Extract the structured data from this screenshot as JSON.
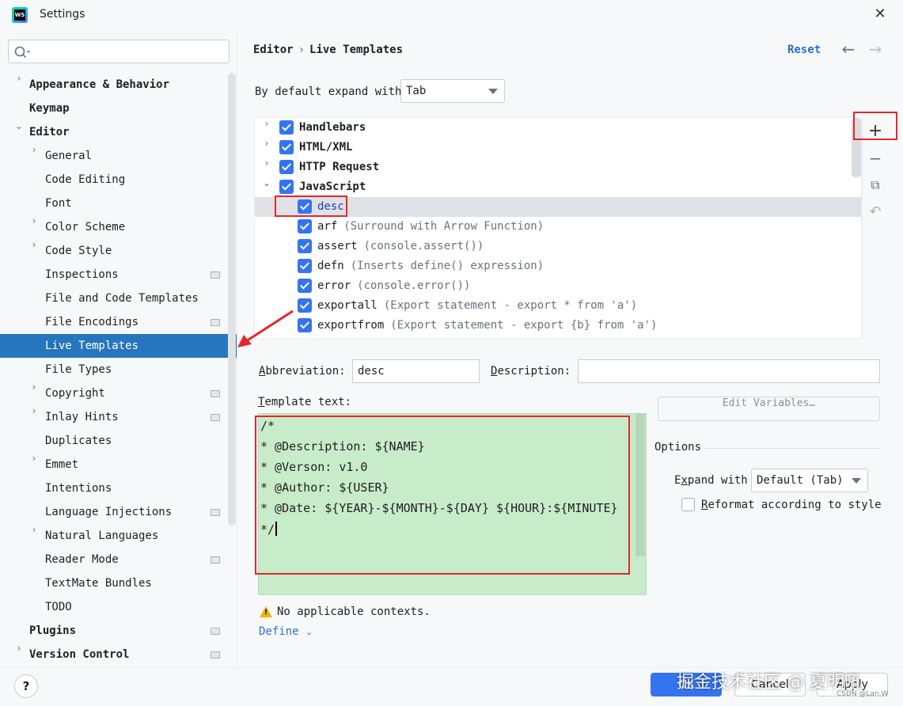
{
  "window": {
    "title": "Settings",
    "logo_text": "WS",
    "close_symbol": "✕"
  },
  "search": {
    "placeholder": ""
  },
  "sidebar": {
    "items": [
      {
        "label": "Appearance & Behavior",
        "level": 0,
        "chevron": "›",
        "bold": true
      },
      {
        "label": "Keymap",
        "level": 0,
        "chevron": "",
        "bold": true
      },
      {
        "label": "Editor",
        "level": 0,
        "chevron": "⌄",
        "bold": true
      },
      {
        "label": "General",
        "level": 1,
        "chevron": "›"
      },
      {
        "label": "Code Editing",
        "level": 1,
        "chevron": ""
      },
      {
        "label": "Font",
        "level": 1,
        "chevron": ""
      },
      {
        "label": "Color Scheme",
        "level": 1,
        "chevron": "›"
      },
      {
        "label": "Code Style",
        "level": 1,
        "chevron": "›"
      },
      {
        "label": "Inspections",
        "level": 1,
        "chevron": "",
        "badge": true
      },
      {
        "label": "File and Code Templates",
        "level": 1,
        "chevron": ""
      },
      {
        "label": "File Encodings",
        "level": 1,
        "chevron": "",
        "badge": true
      },
      {
        "label": "Live Templates",
        "level": 1,
        "chevron": "",
        "selected": true
      },
      {
        "label": "File Types",
        "level": 1,
        "chevron": ""
      },
      {
        "label": "Copyright",
        "level": 1,
        "chevron": "›",
        "badge": true
      },
      {
        "label": "Inlay Hints",
        "level": 1,
        "chevron": "›",
        "badge": true
      },
      {
        "label": "Duplicates",
        "level": 1,
        "chevron": ""
      },
      {
        "label": "Emmet",
        "level": 1,
        "chevron": "›"
      },
      {
        "label": "Intentions",
        "level": 1,
        "chevron": ""
      },
      {
        "label": "Language Injections",
        "level": 1,
        "chevron": "",
        "badge": true
      },
      {
        "label": "Natural Languages",
        "level": 1,
        "chevron": "›"
      },
      {
        "label": "Reader Mode",
        "level": 1,
        "chevron": "",
        "badge": true
      },
      {
        "label": "TextMate Bundles",
        "level": 1,
        "chevron": ""
      },
      {
        "label": "TODO",
        "level": 1,
        "chevron": ""
      },
      {
        "label": "Plugins",
        "level": 0,
        "chevron": "",
        "bold": true,
        "badge": true
      },
      {
        "label": "Version Control",
        "level": 0,
        "chevron": "›",
        "bold": true,
        "badge": true
      }
    ]
  },
  "header": {
    "crumb1": "Editor",
    "crumb_sep": "›",
    "crumb2": "Live Templates",
    "reset": "Reset",
    "back": "←",
    "forward": "→"
  },
  "expand": {
    "label": "By default expand with",
    "value": "Tab"
  },
  "templates": [
    {
      "type": "group",
      "chevron": "›",
      "name": "Handlebars"
    },
    {
      "type": "group",
      "chevron": "›",
      "name": "HTML/XML"
    },
    {
      "type": "group",
      "chevron": "›",
      "name": "HTTP Request"
    },
    {
      "type": "group",
      "chevron": "⌄",
      "name": "JavaScript"
    },
    {
      "type": "item",
      "name": "desc",
      "desc": "",
      "selected": true
    },
    {
      "type": "item",
      "name": "arf",
      "desc": "(Surround with Arrow Function)"
    },
    {
      "type": "item",
      "name": "assert",
      "desc": "(console.assert())"
    },
    {
      "type": "item",
      "name": "defn",
      "desc": "(Inserts define() expression)"
    },
    {
      "type": "item",
      "name": "error",
      "desc": "(console.error())"
    },
    {
      "type": "item",
      "name": "exportall",
      "desc": "(Export statement - export * from 'a')"
    },
    {
      "type": "item",
      "name": "exportfrom",
      "desc": "(Export statement - export {b} from 'a')"
    }
  ],
  "tools": {
    "add": "+",
    "remove": "−",
    "copy": "⧉",
    "revert": "↶"
  },
  "form": {
    "abbreviation_label_u": "A",
    "abbreviation_label_rest": "bbreviation:",
    "abbreviation_value": "desc",
    "description_label_u": "D",
    "description_label_rest": "escription:",
    "description_value": "",
    "template_text_label_u": "T",
    "template_text_label_rest": "emplate text:",
    "template_lines": [
      "/*",
      "* @Description: ${NAME}",
      "* @Verson: v1.0",
      "* @Author: ${USER}",
      "* @Date: ${YEAR}-${MONTH}-${DAY} ${HOUR}:${MINUTE}",
      "*/"
    ],
    "edit_variables": "Edit Variables…",
    "options_title": "Options",
    "expand_with_label_u": "x",
    "expand_with_label_pre": "E",
    "expand_with_label_rest": "pand with",
    "expand_with_value": "Default (Tab)",
    "reformat_label_u": "R",
    "reformat_label_rest": "eformat according to style",
    "warning_text": "No applicable contexts.",
    "define_link": "Define"
  },
  "footer": {
    "help": "?",
    "ok": "OK",
    "cancel": "Cancel",
    "apply": "Apply",
    "watermark": "掘金技术社区 @ 夏明吼",
    "watermark2": "CSDN @Lan.W"
  },
  "colors": {
    "accent": "#3574f0",
    "selection": "#2675bf",
    "template_bg": "#c8ecc9",
    "highlight_box": "#e5262b"
  }
}
